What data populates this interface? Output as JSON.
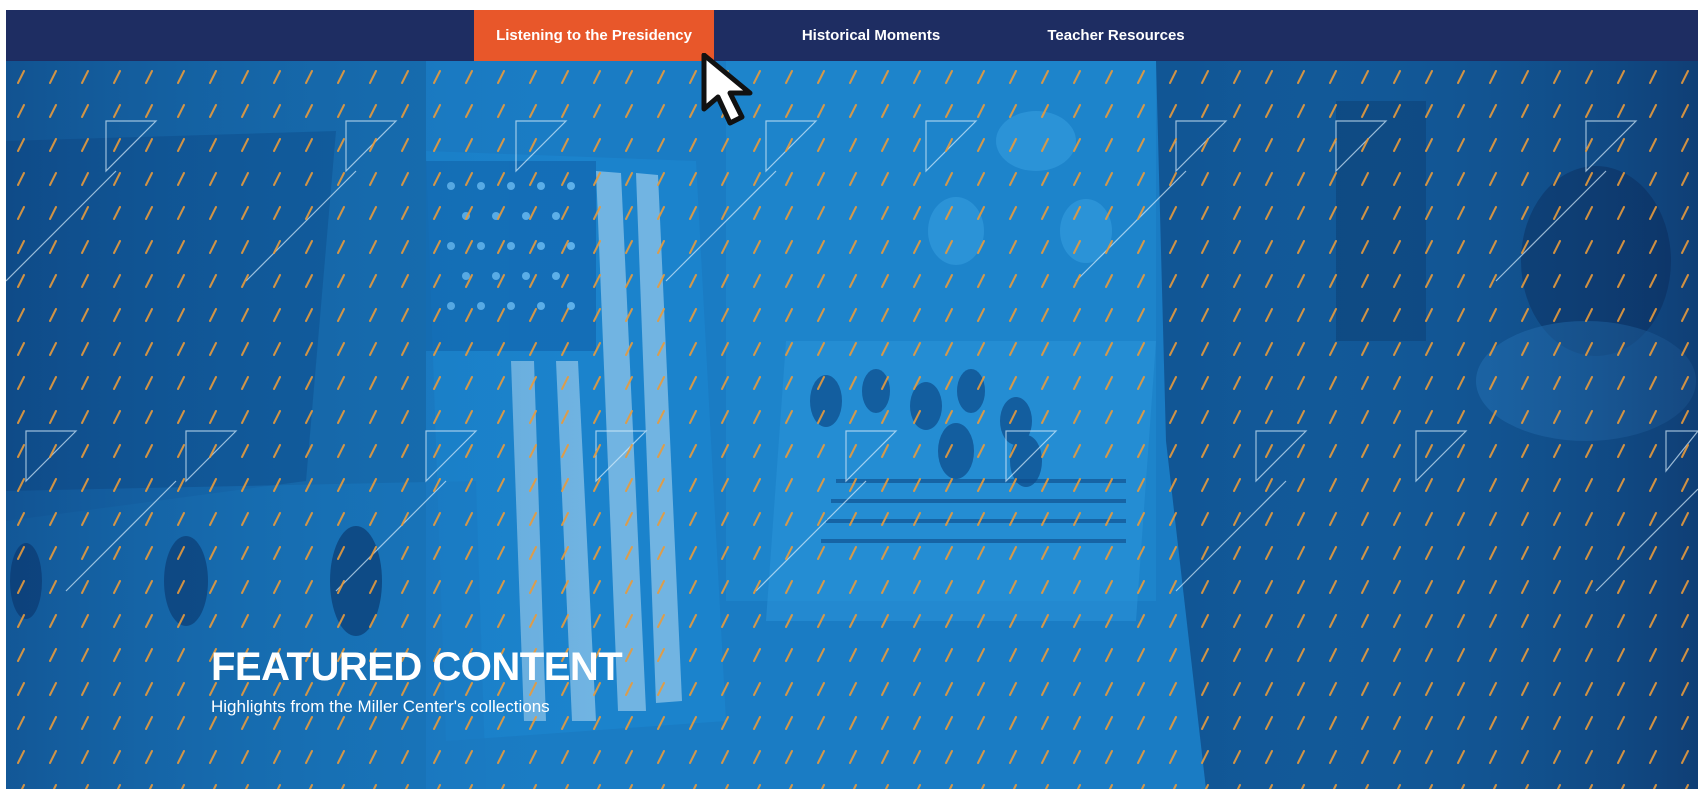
{
  "nav": {
    "items": [
      {
        "label": "Listening to the Presidency",
        "active": true
      },
      {
        "label": "Historical Moments",
        "active": false
      },
      {
        "label": "Teacher Resources",
        "active": false
      }
    ],
    "active_color": "#e8572a",
    "bar_color": "#1e2d62"
  },
  "hero": {
    "title": "FEATURED CONTENT",
    "subtitle": "Highlights from the Miller Center's collections",
    "tint_color": "#1a7cc4",
    "accent_color": "#e89a3a"
  },
  "cursor": {
    "icon": "arrow-pointer-icon"
  }
}
